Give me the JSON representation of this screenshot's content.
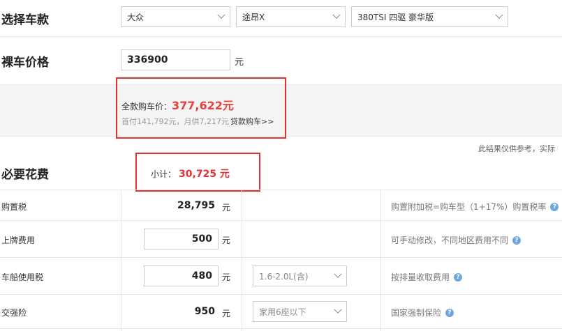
{
  "choose_car": {
    "title": "选择车款",
    "brand": "大众",
    "model": "途昂X",
    "trim": "380TSI 四驱 豪华版"
  },
  "bare_price": {
    "title": "裸车价格",
    "value": "336900",
    "unit": "元"
  },
  "summary": {
    "full_price_label": "全款购车价：",
    "full_price_value": "377,622元",
    "down_monthly": "首付141,792元，月供7,217元",
    "loan_link": "贷款购车>>",
    "disclaimer": "此结果仅供参考，实际"
  },
  "necessary": {
    "title": "必要花费",
    "subtotal_label": "小计：",
    "subtotal_value": "30,725 元"
  },
  "rows": [
    {
      "label": "购置税",
      "value": "28,795",
      "unit": "元",
      "note": "购置附加税=购车型（1+17%）购置税率"
    },
    {
      "label": "上牌费用",
      "value": "500",
      "unit": "元",
      "note": "可手动修改，不同地区费用不同"
    },
    {
      "label": "车船使用税",
      "value": "480",
      "unit": "元",
      "select": "1.6-2.0L(含)",
      "note": "按排量收取费用"
    },
    {
      "label": "交强险",
      "value": "950",
      "unit": "元",
      "select": "家用6座以下",
      "note": "国家强制保险"
    }
  ],
  "colors": {
    "accent_red": "#e03232",
    "value_red": "#e8413c",
    "help_blue": "#6fa7de"
  }
}
